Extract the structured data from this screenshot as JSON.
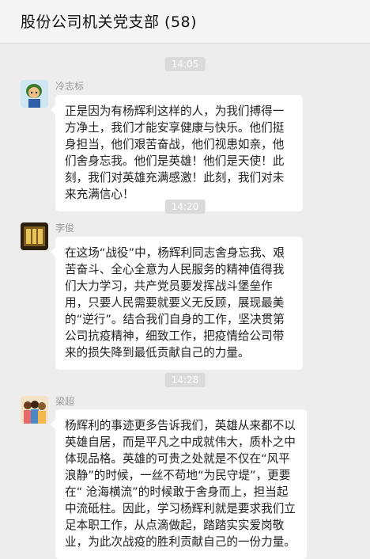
{
  "header": {
    "title": "股份公司机关党支部 (58)"
  },
  "messages": [
    {
      "time": "14:05",
      "sender": "冷志标",
      "avatar_icon": "cartoon-avatar-icon",
      "text": "正是因为有杨辉利这样的人，为我们搏得一方净土，我们才能安享健康与快乐。他们挺身担当，他们艰苦奋战，他们视患如亲，他们舍身忘我。他们是英雄！他们是天使！此刻，我们对英雄充满感激！此刻，我们对未来充满信心！"
    },
    {
      "time": "14:20",
      "sender": "李俊",
      "avatar_icon": "logo-avatar-icon",
      "text": "在这场“战役”中，杨辉利同志舍身忘我、艰苦奋斗、全心全意为人民服务的精神值得我们大力学习，共产党员要发挥战斗堡垒作用，只要人民需要就要义无反顾，展现最美的“逆行”。结合我们自身的工作，坚决贯第公司抗疫精神，细致工作，把疫情给公司带来的损失降到最低贡献自己的力量。"
    },
    {
      "time": "14:28",
      "sender": "梁超",
      "avatar_icon": "family-photo-avatar-icon",
      "text": "杨辉利的事迹更多告诉我们，英雄从来都不以英雄自居，而是平凡之中成就伟大，质朴之中体现品格。英雄的可贵之处就是不仅在“风平浪静”的时候，一丝不苟地“为民守堤”，更要在“ 沧海横流”的时候敢于舍身而上，担当起中流砥柱。因此，学习杨辉利就是要求我们立足本职工作，从点滴做起，踏踏实实爱岗敬业，为此次战疫的胜利贡献自己的一份力量。"
    }
  ]
}
